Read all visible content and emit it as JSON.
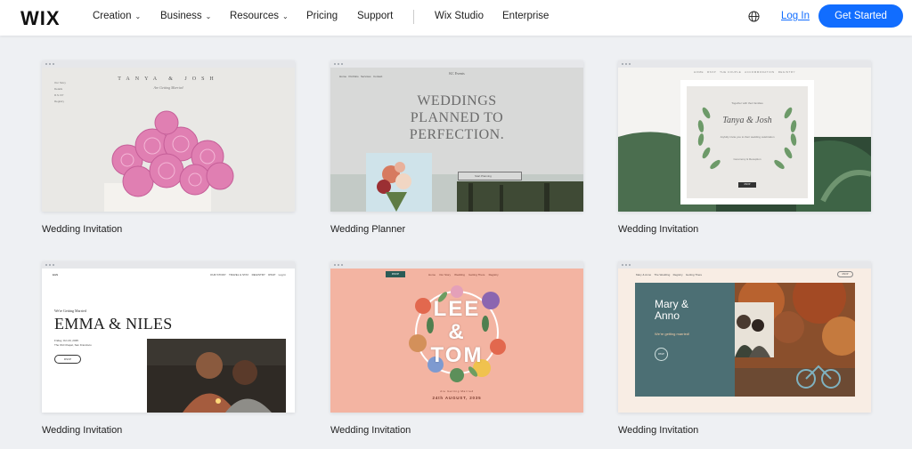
{
  "header": {
    "logo": "WIX",
    "nav": [
      {
        "label": "Creation",
        "dropdown": true
      },
      {
        "label": "Business",
        "dropdown": true
      },
      {
        "label": "Resources",
        "dropdown": true
      },
      {
        "label": "Pricing",
        "dropdown": false
      },
      {
        "label": "Support",
        "dropdown": false
      },
      {
        "label": "Wix Studio",
        "dropdown": false
      },
      {
        "label": "Enterprise",
        "dropdown": false
      }
    ],
    "chevron": "⌄",
    "globe_icon": "globe-icon",
    "login": "Log In",
    "cta": "Get Started",
    "accent_color": "#116dff"
  },
  "templates": [
    {
      "title": "Wedding Invitation"
    },
    {
      "title": "Wedding Planner"
    },
    {
      "title": "Wedding Invitation"
    },
    {
      "title": "Wedding Invitation"
    },
    {
      "title": "Wedding Invitation"
    },
    {
      "title": "Wedding Invitation"
    }
  ],
  "thumbs": {
    "t1": {
      "names": "TANYA & JOSH",
      "sub": "Are Getting Married"
    },
    "t2": {
      "brand": "KC Events",
      "headline_1": "WEDDINGS",
      "headline_2": "PLANNED TO",
      "headline_3": "PERFECTION.",
      "start": "Start Planning"
    },
    "t3": {
      "names": "Tanya & Josh",
      "rsvp": "RSVP"
    },
    "t4": {
      "pre": "We're Getting Married",
      "names": "EMMA & NILES",
      "rsvp": "RSVP"
    },
    "t5": {
      "line1": "LEE",
      "line2": "&",
      "line3": "TOM",
      "small": "Are Getting Married",
      "date": "24th AUGUST, 2035",
      "rsvp": "RSVP"
    },
    "t6": {
      "names_1": "Mary &",
      "names_2": "Anno",
      "going": "We're getting married!",
      "rsvp": "RSVP"
    }
  }
}
